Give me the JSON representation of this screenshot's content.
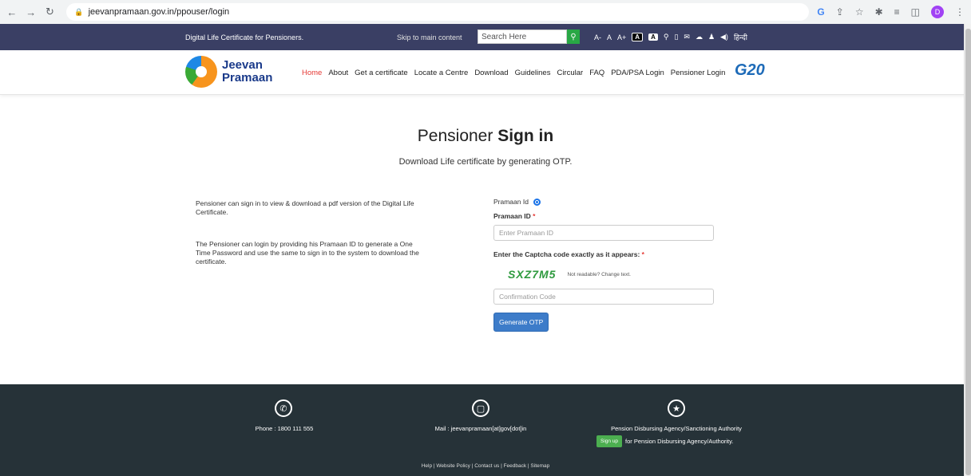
{
  "browser": {
    "url": "jeevanpramaan.gov.in/ppouser/login",
    "profile_initial": "D"
  },
  "topbar": {
    "title": "Digital Life Certificate for Pensioners.",
    "skip": "Skip to main content",
    "search_placeholder": "Search Here",
    "text_sizes": [
      "A-",
      "A",
      "A+"
    ],
    "hindi": "हिन्दी"
  },
  "header": {
    "logo_line1": "Jeevan",
    "logo_line2": "Pramaan",
    "nav": [
      "Home",
      "About",
      "Get a certificate",
      "Locate a Centre",
      "Download",
      "Guidelines",
      "Circular",
      "FAQ",
      "PDA/PSA Login",
      "Pensioner Login"
    ],
    "g20_label": "G20"
  },
  "main": {
    "heading_light": "Pensioner",
    "heading_bold": "Sign in",
    "subheading": "Download Life certificate by generating OTP.",
    "left_p1": "Pensioner can sign in to view & download a pdf version of the Digital Life Certificate.",
    "left_p2": "The Pensioner can login by providing his Pramaan ID to generate a One Time Password and use the same to sign in to the system to download the certificate."
  },
  "form": {
    "radio_label": "Pramaan Id",
    "pramaan_label": "Pramaan ID",
    "pramaan_placeholder": "Enter Pramaan ID",
    "captcha_label": "Enter the Captcha code exactly as it appears:",
    "captcha_code": "SXZ7M5",
    "change_text": "Not readable? Change text.",
    "confirm_placeholder": "Confirmation Code",
    "submit": "Generate OTP",
    "required_mark": "*"
  },
  "footer": {
    "phone": "Phone :  1800 111 555",
    "mail": "Mail : jeevanpramaan[at]gov[dot]in",
    "authority": "Pension Disbursing Agency/Sanctioning Authority",
    "signup": "Sign up",
    "signup_text": "for Pension Disbursing Agency/Authority.",
    "links": "Help | Website Policy | Contact us | Feedback | Sitemap"
  }
}
